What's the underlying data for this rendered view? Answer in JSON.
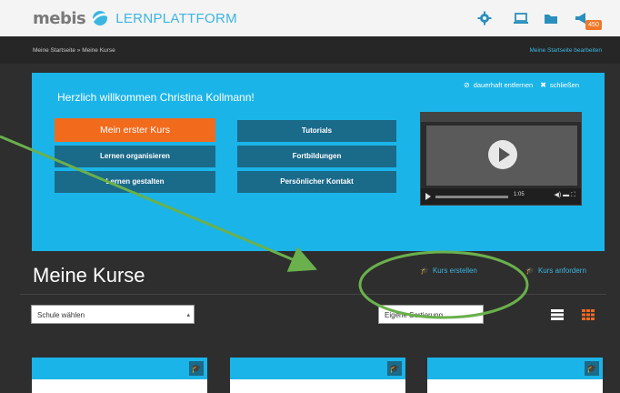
{
  "header": {
    "logo_mebis": "mebis",
    "logo_lern": "LERNPLATTFORM",
    "notification_count": "450"
  },
  "breadcrumb": {
    "text": "Meine Startseite » Meine Kurse",
    "edit_link": "Meine Startseite bearbeiten"
  },
  "welcome": {
    "title": "Herzlich willkommen Christina Kollmann!",
    "remove_label": "dauerhaft entfernen",
    "close_label": "schließen",
    "buttons_left": [
      "Mein erster Kurs",
      "Lernen organisieren",
      "Lernen gestalten"
    ],
    "buttons_right": [
      "Tutorials",
      "Fortbildungen",
      "Persönlicher Kontakt"
    ],
    "video_time": "1:05"
  },
  "courses": {
    "title": "Meine Kurse",
    "create_label": "Kurs erstellen",
    "request_label": "Kurs anfordern",
    "school_select": "Schule wählen",
    "sort_select": "Eigene Sortierung"
  },
  "colors": {
    "accent": "#1bb4e8",
    "orange": "#f26b1d",
    "annotation": "#6ab04c"
  }
}
